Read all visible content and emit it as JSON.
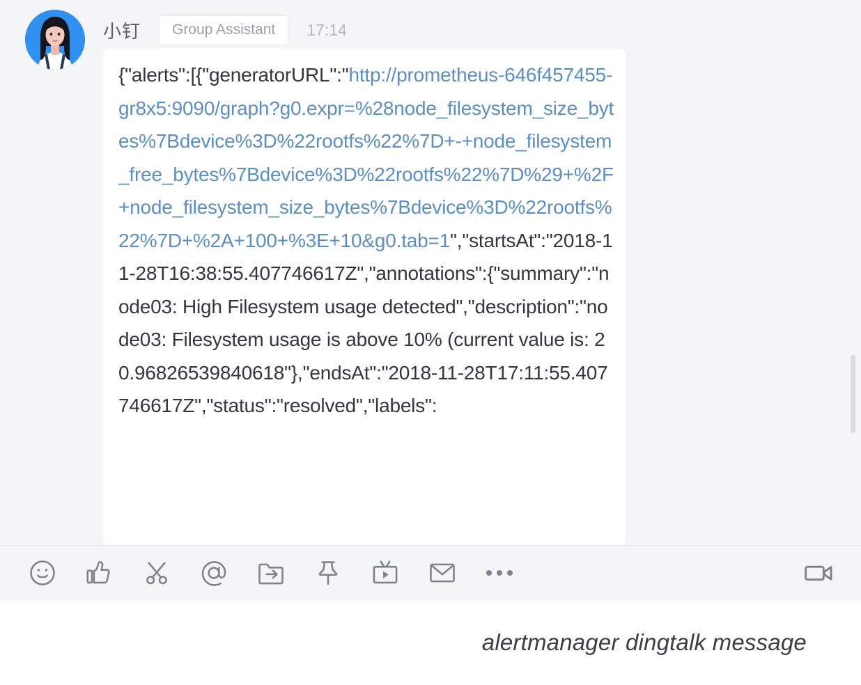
{
  "app": "DingTalk group chat",
  "message": {
    "sender_name": "小钉",
    "sender_tag": "Group Assistant",
    "time": "17:14",
    "avatar_icon": "woman-avatar-icon",
    "body_prefix": "{\"alerts\":[{\"generatorURL\":\"",
    "body_link": "http://prometheus-646f457455-gr8x5:9090/graph?g0.expr=%28node_filesystem_size_bytes%7Bdevice%3D%22rootfs%22%7D+-+node_filesystem_free_bytes%7Bdevice%3D%22rootfs%22%7D%29+%2F+node_filesystem_size_bytes%7Bdevice%3D%22rootfs%22%7D+%2A+100+%3E+10&g0.tab=1",
    "body_suffix": "\",\"startsAt\":\"2018-11-28T16:38:55.407746617Z\",\"annotations\":{\"summary\":\"node03: High Filesystem usage detected\",\"description\":\"node03: Filesystem usage is above 10% (current value is: 20.96826539840618\"},\"endsAt\":\"2018-11-28T17:11:55.407746617Z\",\"status\":\"resolved\",\"labels\":",
    "link_color": "#5a8fc6",
    "text_color": "#33373d",
    "truncated": true
  },
  "toolbar": {
    "left_items": [
      {
        "name": "emoji-icon",
        "label": "Emoji"
      },
      {
        "name": "thumbs-up-icon",
        "label": "Like"
      },
      {
        "name": "scissors-icon",
        "label": "Clip"
      },
      {
        "name": "at-mention-icon",
        "label": "Mention"
      },
      {
        "name": "forward-folder-icon",
        "label": "Forward"
      },
      {
        "name": "pin-icon",
        "label": "Pin"
      },
      {
        "name": "video-board-icon",
        "label": "Play"
      },
      {
        "name": "envelope-icon",
        "label": "Mail"
      },
      {
        "name": "more-ellipsis-icon",
        "label": "More"
      }
    ],
    "right_items": [
      {
        "name": "video-camera-icon",
        "label": "Video call"
      }
    ],
    "icon_color": "#7d838c"
  },
  "scrollbar": {
    "name": "vertical-scrollbar",
    "thumb_color": "#d9dce0"
  },
  "caption": {
    "text": "alertmanager dingtalk message"
  },
  "colors": {
    "panel_background": "#f4f5f7",
    "bubble_background": "#ffffff",
    "page_background": "#ffffff",
    "avatar_background": "#2f90f0"
  }
}
